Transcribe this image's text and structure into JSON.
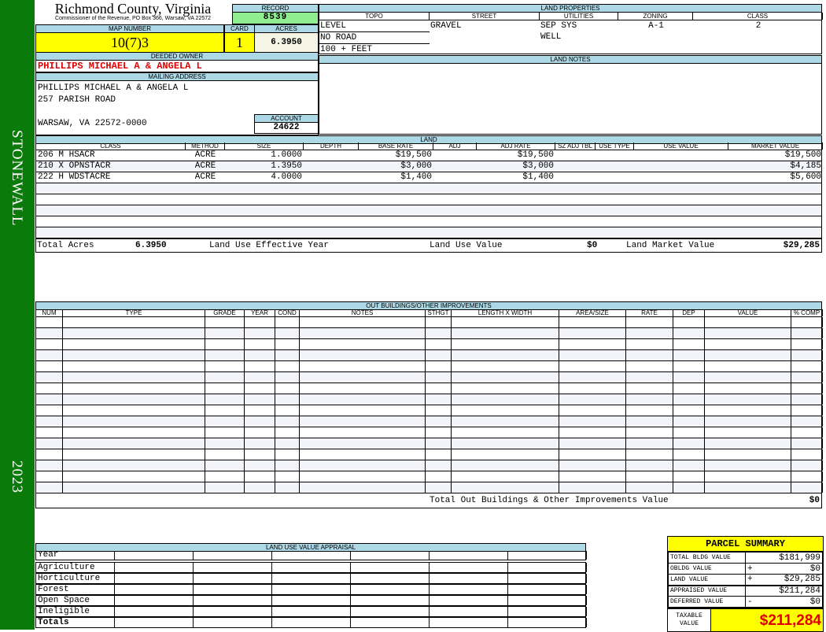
{
  "side": {
    "district": "STONEWALL",
    "year": "2023"
  },
  "header": {
    "title": "Richmond County, Virginia",
    "subtitle": "Commissioner of the Revenue, PO Box 366, Warsaw, VA 22572"
  },
  "record": {
    "label": "RECORD",
    "value": "8539"
  },
  "map": {
    "label": "MAP NUMBER",
    "value": "10(7)3"
  },
  "card": {
    "label": "CARD",
    "value": "1"
  },
  "acres": {
    "label": "ACRES",
    "value": "6.3950"
  },
  "owner": {
    "label": "DEEDED OWNER",
    "value": "PHILLIPS MICHAEL A & ANGELA L"
  },
  "mailing": {
    "label": "MAILING ADDRESS",
    "lines": [
      "PHILLIPS MICHAEL A & ANGELA L",
      "257 PARISH ROAD",
      "",
      "WARSAW, VA 22572-0000"
    ]
  },
  "account": {
    "label": "ACCOUNT",
    "value": "24622"
  },
  "land_properties": {
    "label": "LAND PROPERTIES",
    "columns": [
      "TOPO",
      "STREET",
      "UTILITIES",
      "ZONING",
      "CLASS"
    ],
    "topo": [
      "LEVEL",
      "NO ROAD",
      "100 + FEET"
    ],
    "street": [
      "GRAVEL"
    ],
    "utilities": [
      "SEP SYS",
      "WELL"
    ],
    "zoning": [
      "A-1"
    ],
    "class": [
      "2"
    ]
  },
  "land_notes": {
    "label": "LAND NOTES"
  },
  "land": {
    "label": "LAND",
    "columns": [
      "CLASS",
      "METHOD",
      "SIZE",
      "DEPTH",
      "BASE RATE",
      "ADJ",
      "ADJ RATE",
      "SZ ADJ TBL",
      "USE TYPE",
      "USE VALUE",
      "MARKET VALUE"
    ],
    "rows": [
      [
        "206 M HSACR",
        "ACRE",
        "1.0000",
        "",
        "$19,500",
        "",
        "$19,500",
        "",
        "",
        "",
        "$19,500"
      ],
      [
        "210 X OPNSTACR",
        "ACRE",
        "1.3950",
        "",
        "$3,000",
        "",
        "$3,000",
        "",
        "",
        "",
        "$4,185"
      ],
      [
        "222 H WDSTACRE",
        "ACRE",
        "4.0000",
        "",
        "$1,400",
        "",
        "$1,400",
        "",
        "",
        "",
        "$5,600"
      ]
    ],
    "totals": {
      "acres_label": "Total Acres",
      "acres": "6.3950",
      "effective_year_label": "Land Use Effective Year",
      "use_value_label": "Land Use Value",
      "use_value": "$0",
      "market_label": "Land Market Value",
      "market": "$29,285"
    }
  },
  "outbuildings": {
    "label": "OUT BUILDINGS/OTHER IMPROVEMENTS",
    "columns": [
      "NUM",
      "TYPE",
      "GRADE",
      "YEAR",
      "COND",
      "NOTES",
      "STHGT",
      "LENGTH X WIDTH",
      "AREA/SIZE",
      "RATE",
      "DEP",
      "VALUE",
      "% COMP"
    ],
    "total_label": "Total Out Buildings & Other Improvements Value",
    "total": "$0"
  },
  "land_use": {
    "label": "LAND USE VALUE APPRAISAL",
    "year_label": "Year",
    "rows": [
      "Agriculture",
      "Horticulture",
      "Forest",
      "Open Space",
      "Ineligible"
    ],
    "totals_label": "Totals"
  },
  "parcel_summary": {
    "title": "PARCEL SUMMARY",
    "rows": [
      {
        "label": "TOTAL BLDG VALUE",
        "sign": "",
        "value": "$181,999"
      },
      {
        "label": "OBLDG VALUE",
        "sign": "+",
        "value": "$0"
      },
      {
        "label": "LAND VALUE",
        "sign": "+",
        "value": "$29,285"
      },
      {
        "label": "APPRAISED VALUE",
        "sign": "",
        "value": "$211,284"
      },
      {
        "label": "DEFERRED VALUE",
        "sign": "-",
        "value": "$0"
      }
    ],
    "taxable_label": "TAXABLE VALUE",
    "taxable": "$211,284"
  },
  "colors": {
    "green": "#0a7a0a",
    "header_blue": "#add8e6",
    "yellow": "#ffff00",
    "record_green": "#90ee90",
    "owner_red": "#e00000"
  }
}
